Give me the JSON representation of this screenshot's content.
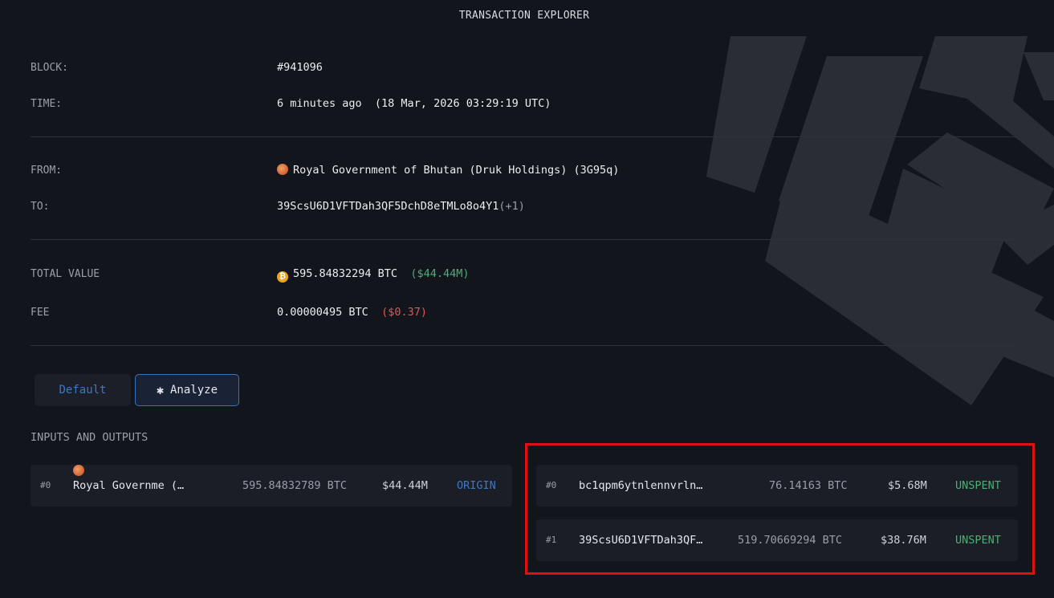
{
  "header": {
    "title": "TRANSACTION EXPLORER"
  },
  "details": {
    "block_label": "BLOCK:",
    "block_value": "#941096",
    "time_label": "TIME:",
    "time_value": "6 minutes ago  (18 Mar, 2026 03:29:19 UTC)",
    "from_label": "FROM:",
    "from_value": "Royal Government of Bhutan (Druk Holdings) (3G95q)",
    "to_label": "TO:",
    "to_value": "39ScsU6D1VFTDah3QF5DchD8eTMLo8o4Y1",
    "to_extra": "(+1)",
    "total_label": "TOTAL VALUE",
    "total_value": "595.84832294 BTC",
    "total_usd": "($44.44M)",
    "fee_label": "FEE",
    "fee_value": "0.00000495 BTC",
    "fee_usd": "($0.37)"
  },
  "tabs": {
    "default_label": "Default",
    "analyze_label": "Analyze",
    "selected": "Analyze"
  },
  "io": {
    "title": "INPUTS AND OUTPUTS",
    "inputs": [
      {
        "index": "#0",
        "name": "Royal Governme (…",
        "amount": "595.84832789 BTC",
        "usd": "$44.44M",
        "status": "ORIGIN"
      }
    ],
    "outputs": [
      {
        "index": "#0",
        "address": "bc1qpm6ytnlennvrln…",
        "amount": "76.14163 BTC",
        "usd": "$5.68M",
        "status": "UNSPENT"
      },
      {
        "index": "#1",
        "address": "39ScsU6D1VFTDah3QF…",
        "amount": "519.70669294 BTC",
        "usd": "$38.76M",
        "status": "UNSPENT"
      }
    ]
  },
  "colors": {
    "background": "#13151c",
    "accent_blue": "#3a78c9",
    "positive": "#4caf73",
    "negative": "#e25454",
    "highlight": "#e01010"
  },
  "icons": {
    "from_entity": "bhutan-flag-icon",
    "total_value": "bitcoin-icon",
    "input_entity": "bhutan-flag-icon",
    "analyze": "analyze-icon"
  }
}
